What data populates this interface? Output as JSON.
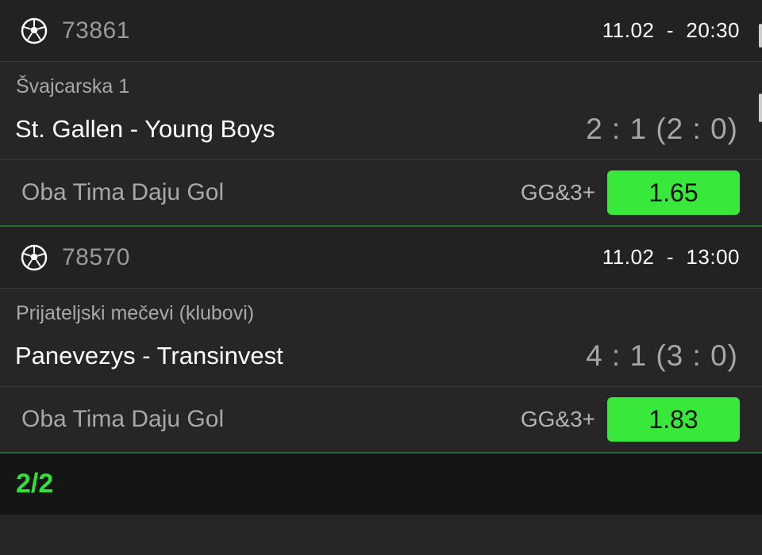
{
  "tickets": [
    {
      "event_code": "73861",
      "datetime": "11.02  -  20:30",
      "league": "Švajcarska 1",
      "match": "St. Gallen - Young Boys",
      "score": "2 : 1 (2 : 0)",
      "market": "Oba Tima Daju Gol",
      "pick": "GG&3+",
      "odd": "1.65",
      "sport_icon": "soccer-ball-icon"
    },
    {
      "event_code": "78570",
      "datetime": "11.02  -  13:00",
      "league": "Prijateljski mečevi (klubovi)",
      "match": "Panevezys - Transinvest",
      "score": "4 : 1 (3 : 0)",
      "market": "Oba Tima Daju Gol",
      "pick": "GG&3+",
      "odd": "1.83",
      "sport_icon": "soccer-ball-icon"
    }
  ],
  "footer": {
    "count": "2/2"
  },
  "colors": {
    "accent": "#38e83b",
    "background": "#262626",
    "header_bg": "#222222",
    "footer_bg": "#151515"
  }
}
